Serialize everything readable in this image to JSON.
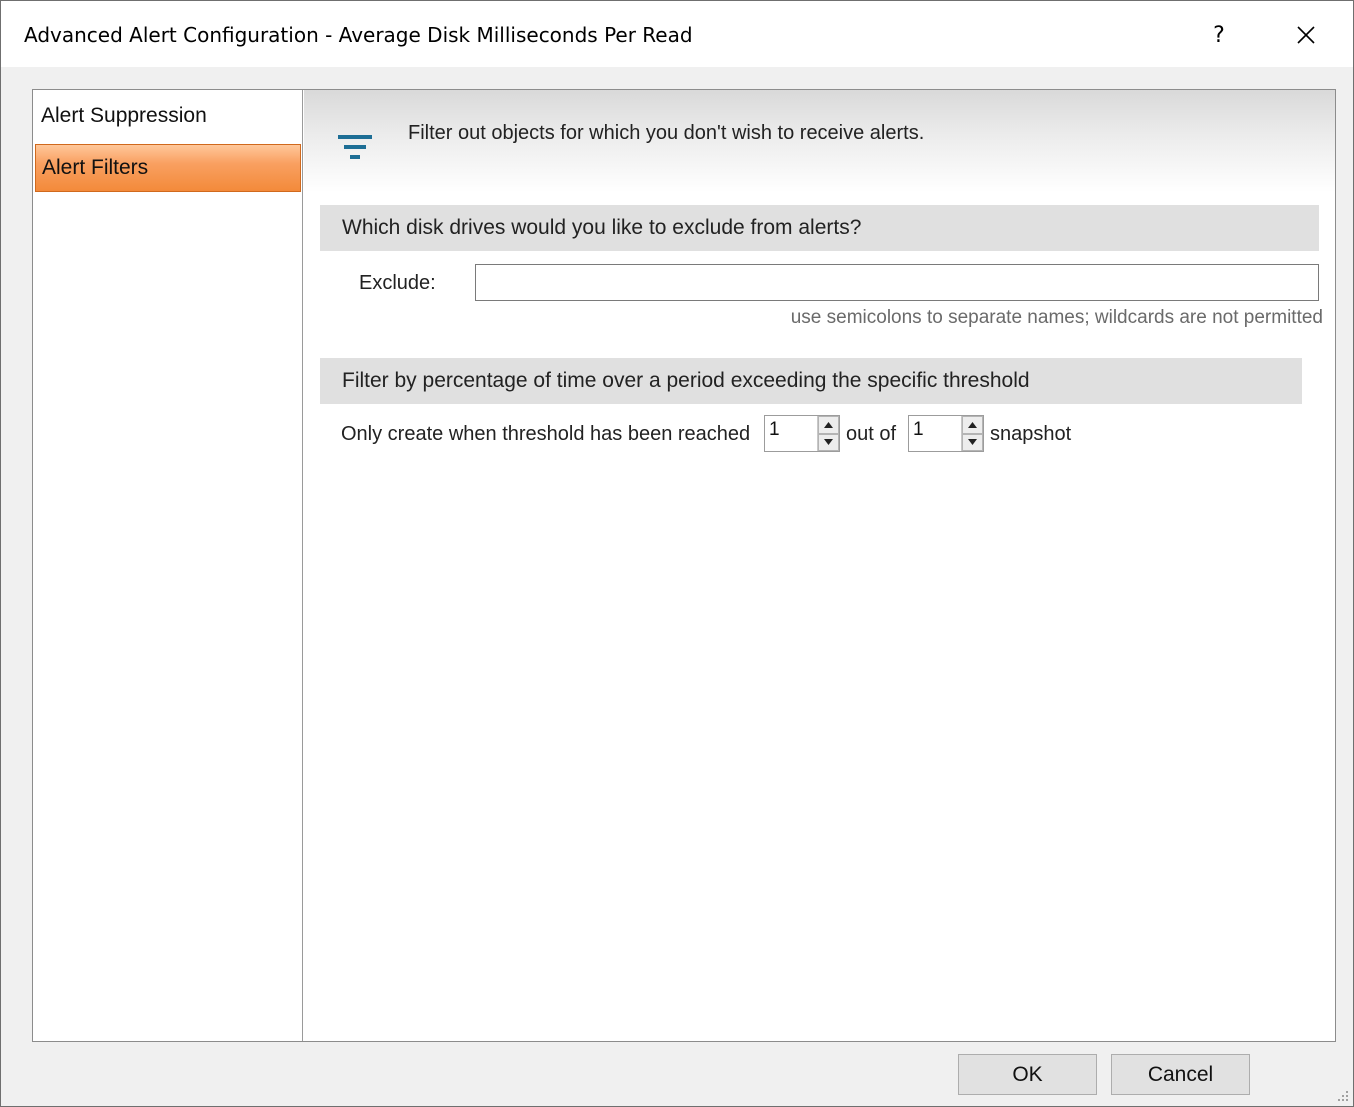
{
  "window": {
    "title": "Advanced Alert Configuration - Average Disk Milliseconds Per Read",
    "help_label": "?",
    "close_label": "✕"
  },
  "nav": {
    "items": [
      {
        "label": "Alert Suppression",
        "selected": false
      },
      {
        "label": "Alert Filters",
        "selected": true
      }
    ]
  },
  "content": {
    "header_text": "Filter out objects for which you don't wish to receive alerts.",
    "icon": "filter-icon",
    "section1": {
      "title": "Which disk drives would you like to exclude from alerts?",
      "exclude_label": "Exclude:",
      "exclude_value": "",
      "hint": "use semicolons to separate names; wildcards are not permitted"
    },
    "section2": {
      "title": "Filter by percentage of time over a period exceeding the specific threshold",
      "prefix": "Only create when threshold has been reached",
      "reached_value": "1",
      "mid": "out of",
      "snapshot_value": "1",
      "suffix": "snapshot"
    }
  },
  "buttons": {
    "ok": "OK",
    "cancel": "Cancel"
  },
  "colors": {
    "selected_nav": "#f59a4f",
    "icon_accent": "#1d6e95"
  }
}
